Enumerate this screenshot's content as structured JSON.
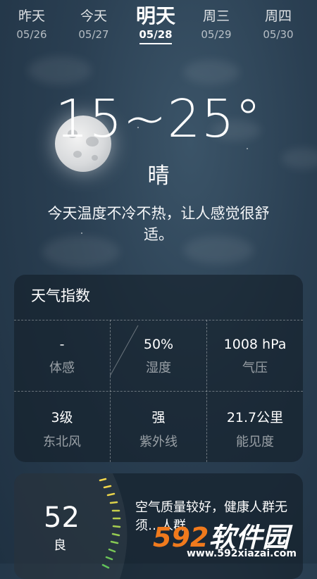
{
  "days": [
    {
      "name": "昨天",
      "date": "05/26"
    },
    {
      "name": "今天",
      "date": "05/27"
    },
    {
      "name": "明天",
      "date": "05/28"
    },
    {
      "name": "周三",
      "date": "05/29"
    },
    {
      "name": "周四",
      "date": "05/30"
    }
  ],
  "selected_day_index": 2,
  "weather": {
    "temp_range": "15~25°",
    "condition": "晴",
    "description": "今天温度不冷不热，让人感觉很舒适。"
  },
  "index_card": {
    "title": "天气指数",
    "items": [
      {
        "value": "-",
        "label": "体感"
      },
      {
        "value": "50%",
        "label": "湿度"
      },
      {
        "value": "1008 hPa",
        "label": "气压"
      },
      {
        "value": "3级",
        "label": "东北风"
      },
      {
        "value": "强",
        "label": "紫外线"
      },
      {
        "value": "21.7公里",
        "label": "能见度"
      }
    ]
  },
  "air_card": {
    "aqi": "52",
    "level": "良",
    "text": "空气质量较好，健康人群无须…人群"
  },
  "watermark": {
    "brand_num": "592",
    "brand_text": "软件园",
    "url": "www.592xiazai.com"
  },
  "colors": {
    "accent": "#f07a1d",
    "background": "#2a3f52"
  }
}
